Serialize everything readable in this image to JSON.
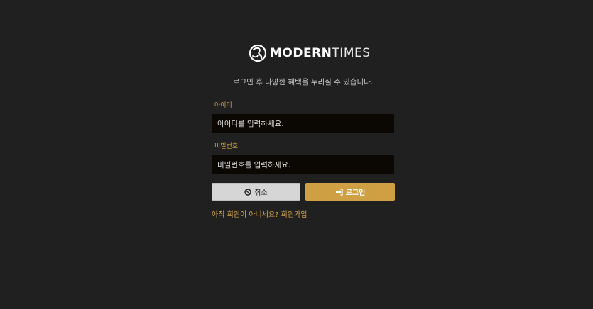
{
  "brand": {
    "name_bold": "MODERN",
    "name_light": "TIMES"
  },
  "login": {
    "subtitle": "로그인 후 다양한 혜택을 누리실 수 있습니다.",
    "id_label": "아이디",
    "id_placeholder": "아이디를 입력하세요.",
    "password_label": "비밀번호",
    "password_placeholder": "비밀번호를 입력하세요.",
    "cancel_label": "취소",
    "submit_label": "로그인",
    "signup_text": "아직 회원이 아니세요? 회원가입"
  },
  "icons": {
    "cancel": "ban-icon",
    "submit": "sign-in-icon",
    "logo": "modern-times-logo-icon"
  },
  "colors": {
    "background": "#202020",
    "accent": "#cfa043",
    "input_bg": "#0b0703",
    "cancel_bg": "#d6d6d6"
  }
}
